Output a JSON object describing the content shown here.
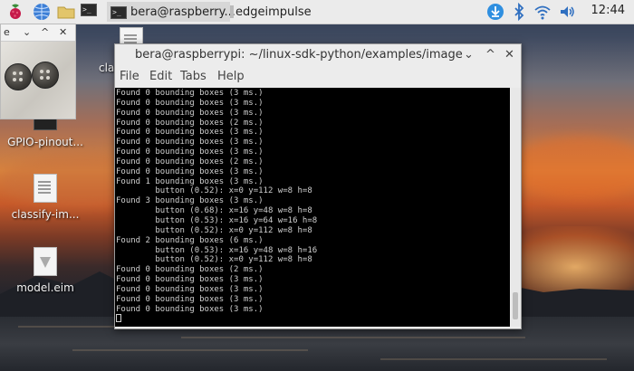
{
  "taskbar": {
    "terminal_btn_1": "bera@raspberry...",
    "folder_btn": "edgeimpulse",
    "clock": "12:44"
  },
  "desktop": {
    "items": [
      {
        "label": "cla"
      },
      {
        "label": "GPIO-pinout..."
      },
      {
        "label": "classify-im..."
      },
      {
        "label": "model.eim"
      }
    ]
  },
  "viewer": {
    "title": "e",
    "ctrl_down": "⌄",
    "ctrl_up": "^",
    "ctrl_close": "✕"
  },
  "terminal": {
    "title": "bera@raspberrypi: ~/linux-sdk-python/examples/image",
    "ctrl_min": "⌄",
    "ctrl_max": "^",
    "ctrl_close": "✕",
    "menu": [
      "File",
      "Edit",
      "Tabs",
      "Help"
    ],
    "lines": [
      "Found 0 bounding boxes (3 ms.)",
      "Found 0 bounding boxes (3 ms.)",
      "Found 0 bounding boxes (3 ms.)",
      "Found 0 bounding boxes (2 ms.)",
      "Found 0 bounding boxes (3 ms.)",
      "Found 0 bounding boxes (3 ms.)",
      "Found 0 bounding boxes (3 ms.)",
      "Found 0 bounding boxes (2 ms.)",
      "Found 0 bounding boxes (3 ms.)",
      "Found 1 bounding boxes (3 ms.)",
      "        button (0.52): x=0 y=112 w=8 h=8",
      "Found 3 bounding boxes (3 ms.)",
      "        button (0.68): x=16 y=48 w=8 h=8",
      "        button (0.53): x=16 y=64 w=16 h=8",
      "        button (0.52): x=0 y=112 w=8 h=8",
      "Found 2 bounding boxes (6 ms.)",
      "        button (0.53): x=16 y=48 w=8 h=16",
      "        button (0.52): x=0 y=112 w=8 h=8",
      "Found 0 bounding boxes (2 ms.)",
      "Found 0 bounding boxes (3 ms.)",
      "Found 0 bounding boxes (3 ms.)",
      "Found 0 bounding boxes (3 ms.)",
      "Found 0 bounding boxes (3 ms.)"
    ]
  }
}
